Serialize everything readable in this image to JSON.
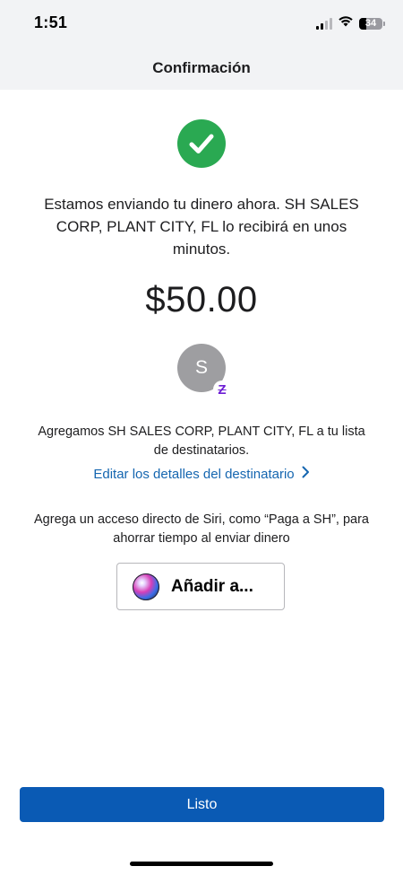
{
  "status_bar": {
    "time": "1:51",
    "battery": "34",
    "icons": [
      "signal-icon",
      "wifi-icon",
      "battery-icon"
    ]
  },
  "header": {
    "title": "Confirmación"
  },
  "confirmation": {
    "icon": "checkmark-circle-icon",
    "message": "Estamos enviando tu dinero ahora. SH SALES CORP, PLANT CITY, FL lo recibirá en unos minutos.",
    "amount": "$50.00"
  },
  "recipient": {
    "avatar_initial": "S",
    "badge_letter": "Z",
    "added_text": "Agregamos SH SALES CORP, PLANT CITY, FL a tu lista de destinatarios.",
    "edit_link": "Editar los detalles del destinatario"
  },
  "siri": {
    "text": "Agrega un acceso directo de Siri, como “Paga a SH”, para ahorrar tiempo al enviar dinero",
    "button_label": "Añadir a..."
  },
  "footer": {
    "done_label": "Listo"
  },
  "colors": {
    "header_bg": "#f2f3f5",
    "success_green": "#2aa952",
    "link_blue": "#1566b0",
    "primary_button": "#0a5ab4",
    "zelle_purple": "#6d1ed4",
    "avatar_gray": "#9e9ea1"
  }
}
